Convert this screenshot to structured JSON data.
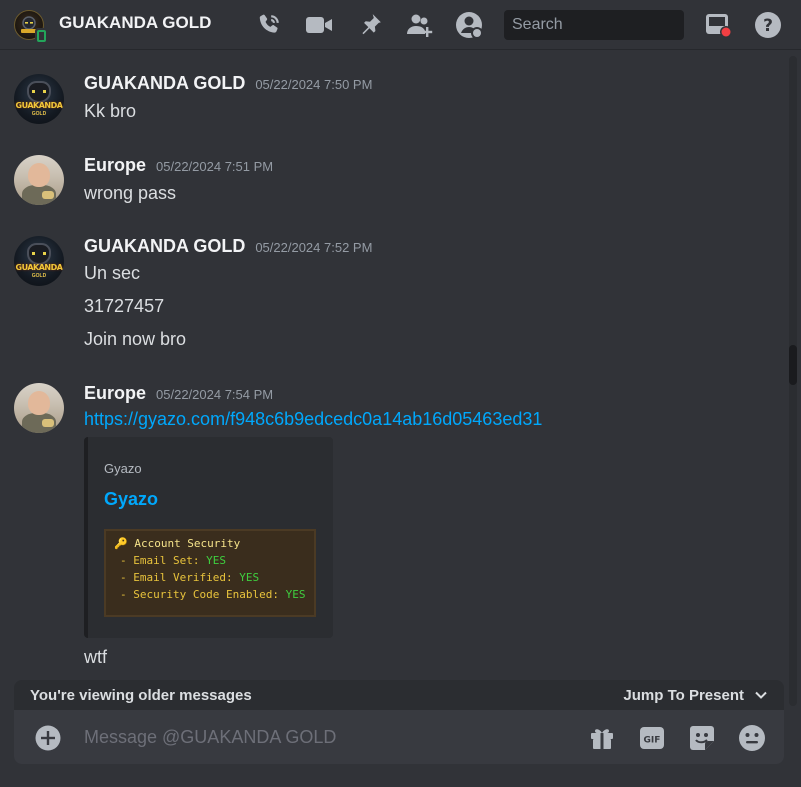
{
  "header": {
    "title": "GUAKANDA GOLD",
    "search_placeholder": "Search",
    "icons": [
      "phone-call-icon",
      "video-camera-icon",
      "pin-icon",
      "add-friend-icon",
      "profile-icon",
      "inbox-icon",
      "help-icon"
    ]
  },
  "messages": [
    {
      "author": "GUAKANDA GOLD",
      "timestamp": "05/22/2024 7:50 PM",
      "lines": [
        "Kk bro"
      ],
      "avatar": "guakanda-logo"
    },
    {
      "author": "Europe",
      "timestamp": "05/22/2024 7:51 PM",
      "lines": [
        "wrong pass"
      ],
      "avatar": "baby-photo"
    },
    {
      "author": "GUAKANDA GOLD",
      "timestamp": "05/22/2024 7:52 PM",
      "lines": [
        "Un sec",
        "31727457",
        "Join now bro"
      ],
      "avatar": "guakanda-logo"
    },
    {
      "author": "Europe",
      "timestamp": "05/22/2024 7:54 PM",
      "link": "https://gyazo.com/f948c6b9edcedc0a14ab16d05463ed31",
      "embed": {
        "provider": "Gyazo",
        "title": "Gyazo",
        "image_text": {
          "heading": "Account Security",
          "rows": [
            {
              "label": "- Email Set:",
              "value": "YES"
            },
            {
              "label": "- Email Verified:",
              "value": "YES"
            },
            {
              "label": "- Security Code Enabled:",
              "value": "YES"
            }
          ]
        }
      },
      "after": "wtf",
      "avatar": "baby-photo"
    }
  ],
  "older_bar": {
    "text": "You're viewing older messages",
    "jump_label": "Jump To Present"
  },
  "composer": {
    "placeholder": "Message @GUAKANDA GOLD"
  },
  "logo_text": {
    "line1": "GUAKANDA",
    "line2": "GOLD"
  },
  "colors": {
    "background": "#313338",
    "link": "#00a8fc",
    "online": "#23a55a",
    "notification": "#f23f43"
  }
}
